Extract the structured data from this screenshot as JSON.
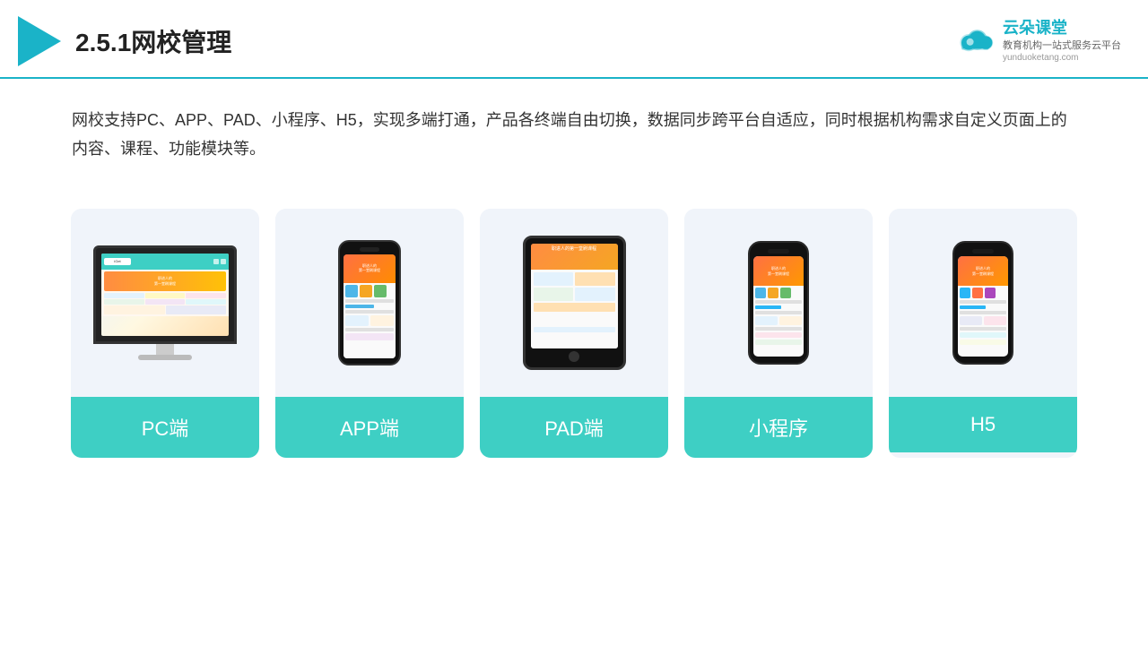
{
  "header": {
    "title": "2.5.1网校管理",
    "brand": {
      "name": "云朵课堂",
      "url": "yunduoketang.com",
      "tagline": "教育机构一站式服务云平台"
    }
  },
  "description": {
    "text": "网校支持PC、APP、PAD、小程序、H5，实现多端打通，产品各终端自由切换，数据同步跨平台自适应，同时根据机构需求自定义页面上的内容、课程、功能模块等。"
  },
  "cards": [
    {
      "id": "pc",
      "label": "PC端"
    },
    {
      "id": "app",
      "label": "APP端"
    },
    {
      "id": "pad",
      "label": "PAD端"
    },
    {
      "id": "miniprogram",
      "label": "小程序"
    },
    {
      "id": "h5",
      "label": "H5"
    }
  ],
  "colors": {
    "accent": "#3ecfc4",
    "header_line": "#1ab3c8",
    "triangle": "#1ab3c8",
    "brand_color": "#1ab3c8"
  }
}
